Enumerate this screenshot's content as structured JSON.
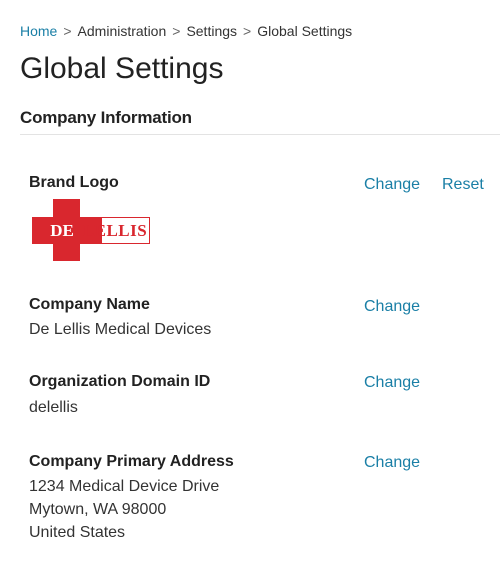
{
  "breadcrumb": {
    "items": [
      {
        "label": "Home"
      },
      {
        "label": "Administration"
      },
      {
        "label": "Settings"
      },
      {
        "label": "Global Settings"
      }
    ],
    "separator": ">"
  },
  "page": {
    "title": "Global Settings"
  },
  "section": {
    "heading": "Company Information"
  },
  "fields": {
    "brand_logo": {
      "label": "Brand Logo",
      "logo_text_left": "DE",
      "logo_text_right": "LELLIS",
      "change_label": "Change",
      "reset_label": "Reset"
    },
    "company_name": {
      "label": "Company Name",
      "value": "De Lellis Medical Devices",
      "change_label": "Change"
    },
    "domain_id": {
      "label": "Organization Domain ID",
      "value": "delellis",
      "change_label": "Change"
    },
    "address": {
      "label": "Company Primary Address",
      "lines": [
        "1234 Medical Device Drive",
        "Mytown, WA 98000",
        "United States"
      ],
      "change_label": "Change"
    }
  },
  "colors": {
    "link": "#1a7fa6",
    "logo_red": "#d9272e"
  }
}
